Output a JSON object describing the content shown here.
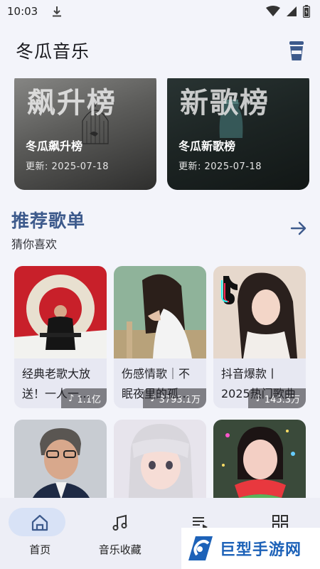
{
  "status": {
    "time": "10:03"
  },
  "header": {
    "title": "冬瓜音乐"
  },
  "rankings": [
    {
      "big": "飙升榜",
      "name": "冬瓜飙升榜",
      "date": "更新: 2025-07-18"
    },
    {
      "big": "新歌榜",
      "name": "冬瓜新歌榜",
      "date": "更新: 2025-07-18"
    }
  ],
  "section": {
    "title": "推荐歌单",
    "subtitle": "猜你喜欢"
  },
  "playlists": [
    {
      "count": "1.1亿",
      "title_line1": "经典老歌大放",
      "title_line2": "送！一人一…"
    },
    {
      "count": "3793.1万",
      "title_line1": "伤感情歌｜不",
      "title_line2": "眠夜里的孤…"
    },
    {
      "count": "145.3万",
      "title_line1": "抖音爆款丨",
      "title_line2": "2025热门歌曲"
    },
    {
      "count": ""
    },
    {
      "count": ""
    },
    {
      "count": ""
    }
  ],
  "nav": [
    {
      "label": "首页",
      "icon": "home-icon",
      "active": true
    },
    {
      "label": "音乐收藏",
      "icon": "music-note-icon",
      "active": false
    },
    {
      "label": "",
      "icon": "playlist-icon",
      "active": false
    },
    {
      "label": "",
      "icon": "grid-icon",
      "active": false
    }
  ],
  "watermark": {
    "text": "巨型手游网"
  },
  "colors": {
    "accent": "#3d5a8c",
    "background": "#f3f4fa",
    "nav_active": "#d8e2f6"
  }
}
